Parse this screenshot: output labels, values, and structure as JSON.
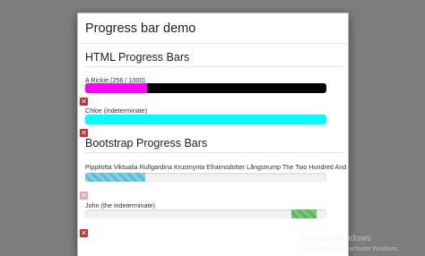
{
  "window": {
    "title": "Progress bar demo"
  },
  "html_section": {
    "title": "HTML Progress Bars",
    "bars": [
      {
        "label": "A Rickie (256 / 1000)",
        "value": 256,
        "max": 1000,
        "fill_color": "#ff00ff",
        "track_color": "#000000"
      },
      {
        "label": "Chloe (indeterminate)",
        "indeterminate": true,
        "fill_color": "#00ffff"
      }
    ]
  },
  "bootstrap_section": {
    "title": "Bootstrap Progress Bars",
    "bars": [
      {
        "label": "Pippilotta Viktualia Rullgardina Krusmynta Efraimsdotter Långstrump The Two Hundred And",
        "value_fraction": 0.25,
        "style": "striped-info",
        "fill_color": "#5bc0de"
      },
      {
        "label": "John (the indeterminate)",
        "indeterminate": true,
        "style": "striped-success",
        "fill_color": "#5cb85c"
      }
    ]
  },
  "icons": {
    "remove": "close-icon"
  },
  "remove_glyph": "✕",
  "watermark": {
    "title": "Activate Windows",
    "subtitle": "Go to Settings to activate Windows."
  }
}
